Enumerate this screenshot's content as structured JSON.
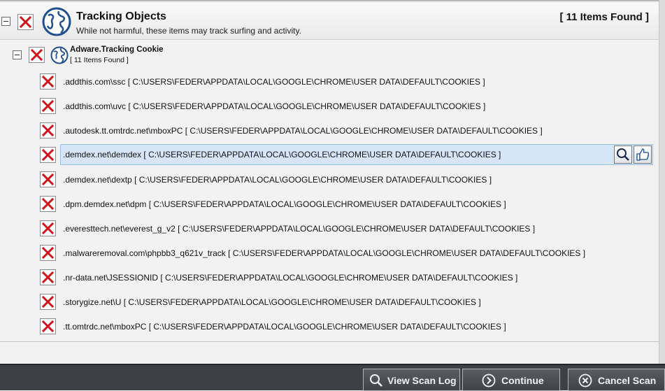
{
  "category": {
    "title": "Tracking Objects",
    "description": "While not harmful, these items may track surfing and activity.",
    "count": "[ 11 Items Found ]"
  },
  "subcategory": {
    "title": "Adware.Tracking Cookie",
    "count": "[ 11 Items Found ]"
  },
  "items": [
    ".addthis.com\\ssc [ C:\\USERS\\FEDER\\APPDATA\\LOCAL\\GOOGLE\\CHROME\\USER DATA\\DEFAULT\\COOKIES ]",
    ".addthis.com\\uvc [ C:\\USERS\\FEDER\\APPDATA\\LOCAL\\GOOGLE\\CHROME\\USER DATA\\DEFAULT\\COOKIES ]",
    ".autodesk.tt.omtrdc.net\\mboxPC [ C:\\USERS\\FEDER\\APPDATA\\LOCAL\\GOOGLE\\CHROME\\USER DATA\\DEFAULT\\COOKIES ]",
    ".demdex.net\\demdex [ C:\\USERS\\FEDER\\APPDATA\\LOCAL\\GOOGLE\\CHROME\\USER DATA\\DEFAULT\\COOKIES ]",
    ".demdex.net\\dextp [ C:\\USERS\\FEDER\\APPDATA\\LOCAL\\GOOGLE\\CHROME\\USER DATA\\DEFAULT\\COOKIES ]",
    ".dpm.demdex.net\\dpm [ C:\\USERS\\FEDER\\APPDATA\\LOCAL\\GOOGLE\\CHROME\\USER DATA\\DEFAULT\\COOKIES ]",
    ".everesttech.net\\everest_g_v2 [ C:\\USERS\\FEDER\\APPDATA\\LOCAL\\GOOGLE\\CHROME\\USER DATA\\DEFAULT\\COOKIES ]",
    ".malwareremoval.com\\phpbb3_q621v_track [ C:\\USERS\\FEDER\\APPDATA\\LOCAL\\GOOGLE\\CHROME\\USER DATA\\DEFAULT\\COOKIES ]",
    ".nr-data.net\\JSESSIONID [ C:\\USERS\\FEDER\\APPDATA\\LOCAL\\GOOGLE\\CHROME\\USER DATA\\DEFAULT\\COOKIES ]",
    ".storygize.net\\U [ C:\\USERS\\FEDER\\APPDATA\\LOCAL\\GOOGLE\\CHROME\\USER DATA\\DEFAULT\\COOKIES ]",
    ".tt.omtrdc.net\\mboxPC [ C:\\USERS\\FEDER\\APPDATA\\LOCAL\\GOOGLE\\CHROME\\USER DATA\\DEFAULT\\COOKIES ]"
  ],
  "footer": {
    "view_log_label": "View Scan Log",
    "continue_label": "Continue",
    "cancel_label": "Cancel Scan"
  },
  "colors": {
    "mark_red": "#d0141c",
    "footer_bg": "#3d4044",
    "selected_row": "#d6e6f8",
    "globe_blue": "#1f4f8c"
  },
  "icons": {
    "category_icon": "globe-icon",
    "delete_mark": "red-x-icon",
    "row_actions": [
      "magnifier-icon",
      "thumbs-up-icon"
    ],
    "footer": [
      "magnifier-icon",
      "arrow-circle-icon",
      "x-circle-icon"
    ]
  }
}
